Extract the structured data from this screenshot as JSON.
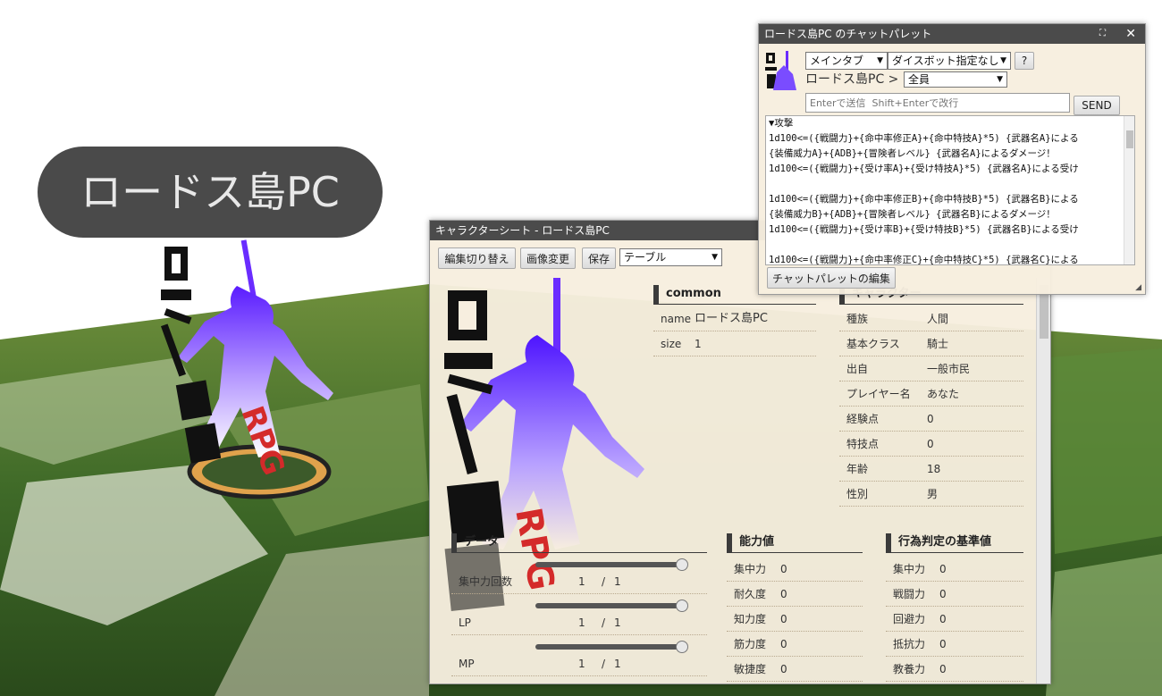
{
  "scene": {
    "nameplate": "ロードス島PC"
  },
  "character_sheet": {
    "title": "キャラクターシート - ロードス島PC",
    "toolbar": {
      "edit_toggle": "編集切り替え",
      "change_image": "画像変更",
      "save": "保存",
      "layout_select": "テーブル"
    },
    "common": {
      "heading": "common",
      "rows": [
        {
          "key": "name",
          "value": "ロードス島PC"
        },
        {
          "key": "size",
          "value": "1"
        }
      ]
    },
    "character": {
      "heading": "キャラクター",
      "rows": [
        {
          "key": "種族",
          "value": "人間"
        },
        {
          "key": "基本クラス",
          "value": "騎士"
        },
        {
          "key": "出自",
          "value": "一般市民"
        },
        {
          "key": "プレイヤー名",
          "value": "あなた"
        },
        {
          "key": "経験点",
          "value": "0"
        },
        {
          "key": "特技点",
          "value": "0"
        },
        {
          "key": "年齢",
          "value": "18"
        },
        {
          "key": "性別",
          "value": "男"
        }
      ]
    },
    "data": {
      "heading": "データ",
      "resources": [
        {
          "label": "集中力回数",
          "current": "1",
          "sep": "/",
          "max": "1",
          "fill": 1.0
        },
        {
          "label": "LP",
          "current": "1",
          "sep": "/",
          "max": "1",
          "fill": 1.0
        },
        {
          "label": "MP",
          "current": "1",
          "sep": "/",
          "max": "1",
          "fill": 1.0
        }
      ]
    },
    "abilities": {
      "heading": "能力値",
      "rows": [
        {
          "key": "集中力",
          "value": "0"
        },
        {
          "key": "耐久度",
          "value": "0"
        },
        {
          "key": "知力度",
          "value": "0"
        },
        {
          "key": "筋力度",
          "value": "0"
        },
        {
          "key": "敏捷度",
          "value": "0"
        }
      ]
    },
    "checks": {
      "heading": "行為判定の基準値",
      "rows": [
        {
          "key": "集中力",
          "value": "0"
        },
        {
          "key": "戦闘力",
          "value": "0"
        },
        {
          "key": "回避力",
          "value": "0"
        },
        {
          "key": "抵抗力",
          "value": "0"
        },
        {
          "key": "教養力",
          "value": "0"
        }
      ]
    }
  },
  "chat_palette": {
    "title": "ロードス島PC のチャットパレット",
    "tab_select": "メインタブ",
    "dice_select": "ダイスボット指定なし",
    "help": "?",
    "sender": "ロードス島PC",
    "arrow": ">",
    "target_select": "全員",
    "input_placeholder": "Enterで送信  Shift+Enterで改行",
    "send": "SEND",
    "lines": [
      "▼攻撃",
      "1d100<=({戦闘力}+{命中率修正A}+{命中特技A}*5)  {武器名A}による",
      "{装備威力A}+{ADB}+{冒険者レベル}  {武器名A}によるダメージ！",
      "1d100<=({戦闘力}+{受け率A}+{受け特技A}*5)  {武器名A}による受け",
      "",
      "1d100<=({戦闘力}+{命中率修正B}+{命中特技B}*5)  {武器名B}による",
      "{装備威力B}+{ADB}+{冒険者レベル}  {武器名B}によるダメージ！",
      "1d100<=({戦闘力}+{受け率B}+{受け特技B}*5)  {武器名B}による受け",
      "",
      "1d100<=({戦闘力}+{命中率修正C}+{命中特技C}*5)  {武器名C}による"
    ],
    "edit_button": "チャットパレットの編集"
  },
  "colors": {
    "titlebar": "#4b4b4b",
    "panel_bg": "#f7eedf",
    "silhouette_top": "#5a1cff",
    "silhouette_bottom": "#ffffff",
    "rpg_red": "#d42a2a",
    "grass": "#3f7a2c"
  }
}
